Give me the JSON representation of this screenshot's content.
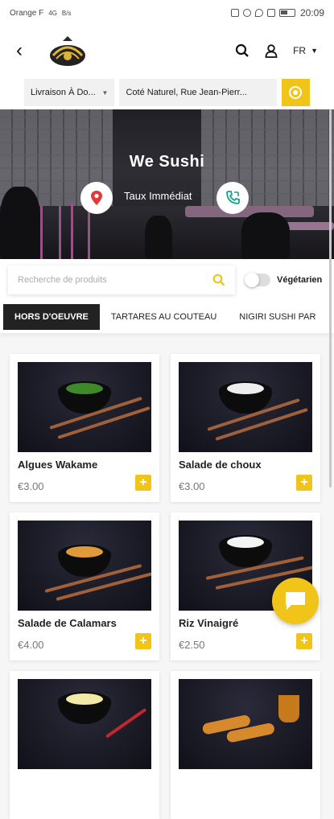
{
  "status_bar": {
    "carrier": "Orange F",
    "network": "4G",
    "speed": "B/s",
    "time": "20:09"
  },
  "header": {
    "language": "FR",
    "brand_color": "#f0c419"
  },
  "address_bar": {
    "delivery_mode": "Livraison À Do...",
    "address": "Coté Naturel, Rue Jean-Pierr..."
  },
  "hero": {
    "restaurant_name": "We Sushi",
    "rate_label": "Taux Immédiat"
  },
  "search": {
    "placeholder": "Recherche de produits",
    "vegetarian_label": "Végétarien"
  },
  "tabs": [
    {
      "label": "HORS D'OEUVRE",
      "active": true
    },
    {
      "label": "TARTARES AU COUTEAU",
      "active": false
    },
    {
      "label": "NIGIRI SUSHI PAR",
      "active": false
    }
  ],
  "products": [
    {
      "name": "Algues Wakame",
      "price": "€3.00",
      "add_label": "+"
    },
    {
      "name": "Salade de choux",
      "price": "€3.00",
      "add_label": "+"
    },
    {
      "name": "Salade de Calamars",
      "price": "€4.00",
      "add_label": "+"
    },
    {
      "name": "Riz Vinaigré",
      "price": "€2.50",
      "add_label": "+"
    },
    {
      "name": "",
      "price": "",
      "add_label": ""
    },
    {
      "name": "",
      "price": "",
      "add_label": ""
    }
  ]
}
